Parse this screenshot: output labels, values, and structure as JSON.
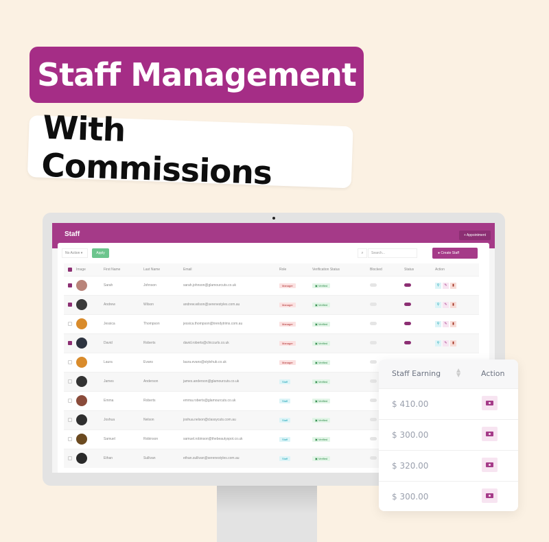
{
  "hero": {
    "title": "Staff Management",
    "subtitle": "With Commissions"
  },
  "app": {
    "title": "Staff",
    "appointment_button": "+ Appointment",
    "bulk_action_select": "No Action ▾",
    "apply_button": "Apply",
    "search_icon": "⌕",
    "search_placeholder": "Search...",
    "create_button": "● Create Staff"
  },
  "table": {
    "columns": [
      "Image",
      "First Name",
      "Last Name",
      "Email",
      "Role",
      "Verification Status",
      "Blocked",
      "Status",
      "Action"
    ],
    "rows": [
      {
        "checked": true,
        "first": "Sarah",
        "last": "Johnson",
        "email": "sarah.johnson@glamourcuts.co.uk",
        "role": "Manager",
        "verification": "Verified",
        "blocked": false,
        "status": true,
        "avatar": "#b9847a"
      },
      {
        "checked": true,
        "first": "Andrew",
        "last": "Wilson",
        "email": "andrew.wilson@serenestyles.com.au",
        "role": "Manager",
        "verification": "Verified",
        "blocked": false,
        "status": true,
        "avatar": "#3a3a3a"
      },
      {
        "checked": false,
        "first": "Jessica",
        "last": "Thompson",
        "email": "jessica.thompson@trendytrims.com.au",
        "role": "Manager",
        "verification": "Verified",
        "blocked": false,
        "status": true,
        "avatar": "#d98b2b"
      },
      {
        "checked": true,
        "first": "David",
        "last": "Roberts",
        "email": "david.roberts@chiccurls.co.uk",
        "role": "Manager",
        "verification": "Verified",
        "blocked": false,
        "status": true,
        "avatar": "#2e3440"
      },
      {
        "checked": false,
        "first": "Laura",
        "last": "Evans",
        "email": "laura.evans@stylehub.co.uk",
        "role": "Manager",
        "verification": "Verified",
        "blocked": false,
        "status": true,
        "avatar": "#d98b2b"
      },
      {
        "checked": false,
        "first": "James",
        "last": "Anderson",
        "email": "james.anderson@glamourcuts.co.uk",
        "role": "Staff",
        "verification": "Verified",
        "blocked": false,
        "status": true,
        "avatar": "#333333"
      },
      {
        "checked": false,
        "first": "Emma",
        "last": "Roberts",
        "email": "emma.roberts@glamourcuts.co.uk",
        "role": "Staff",
        "verification": "Verified",
        "blocked": false,
        "status": true,
        "avatar": "#8a4b3a"
      },
      {
        "checked": false,
        "first": "Joshua",
        "last": "Nelson",
        "email": "joshua.nelson@classycuts.com.au",
        "role": "Staff",
        "verification": "Verified",
        "blocked": false,
        "status": true,
        "avatar": "#2f2f2f"
      },
      {
        "checked": false,
        "first": "Samuel",
        "last": "Robinson",
        "email": "samuel.robinson@thebeautyspot.co.uk",
        "role": "Staff",
        "verification": "Verified",
        "blocked": false,
        "status": true,
        "avatar": "#6b4a20"
      },
      {
        "checked": false,
        "first": "Ethan",
        "last": "Sullivan",
        "email": "ethan.sullivan@serenestyles.com.au",
        "role": "Staff",
        "verification": "Verified",
        "blocked": false,
        "status": true,
        "avatar": "#2a2a2a"
      }
    ]
  },
  "earnings": {
    "columns": [
      "Staff Earning",
      "Action"
    ],
    "rows": [
      "$ 410.00",
      "$ 300.00",
      "$ 320.00",
      "$ 300.00"
    ]
  },
  "colors": {
    "brand": "#a53a88",
    "background": "#fbf1e3",
    "apply": "#6cc58d"
  }
}
